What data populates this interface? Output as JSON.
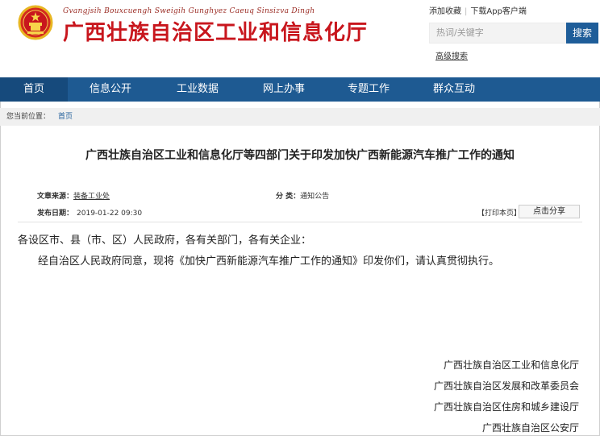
{
  "header": {
    "pinyin": "Gvangjsih Bouxcuengh Sweigih Gunghyez Caeuq Sinsizva Dingh",
    "site_title": "广西壮族自治区工业和信息化厅",
    "top_links": [
      "添加收藏",
      "下载App客户端"
    ],
    "search_placeholder": "热词/关键字",
    "search_button": "搜索",
    "advanced_search": "高级搜索"
  },
  "nav": [
    {
      "label": "首页",
      "active": true
    },
    {
      "label": "信息公开",
      "active": false
    },
    {
      "label": "工业数据",
      "active": false
    },
    {
      "label": "网上办事",
      "active": false
    },
    {
      "label": "专题工作",
      "active": false
    },
    {
      "label": "群众互动",
      "active": false
    }
  ],
  "breadcrumb": {
    "prefix": "您当前位置：",
    "home": "首页"
  },
  "article": {
    "title": "广西壮族自治区工业和信息化厅等四部门关于印发加快广西新能源汽车推广工作的通知",
    "source_label": "文章来源：",
    "source_value": "装备工业处",
    "category_label": "分 类：",
    "category_value": "通知公告",
    "date_label": "发布日期：",
    "date_value": "2019-01-22 09:30",
    "print_label": "【打印本页】",
    "share_label": "点击分享",
    "salutation": "各设区市、县（市、区）人民政府，各有关部门，各有关企业：",
    "paragraph": "经自治区人民政府同意，现将《加快广西新能源汽车推广工作的通知》印发你们，请认真贯彻执行。",
    "signatories": [
      "广西壮族自治区工业和信息化厅",
      "广西壮族自治区发展和改革委员会",
      "广西壮族自治区住房和城乡建设厅",
      "广西壮族自治区公安厅"
    ]
  },
  "colors": {
    "brand_red": "#c8161d",
    "nav_blue": "#1e5a92",
    "nav_active": "#164a7c"
  }
}
